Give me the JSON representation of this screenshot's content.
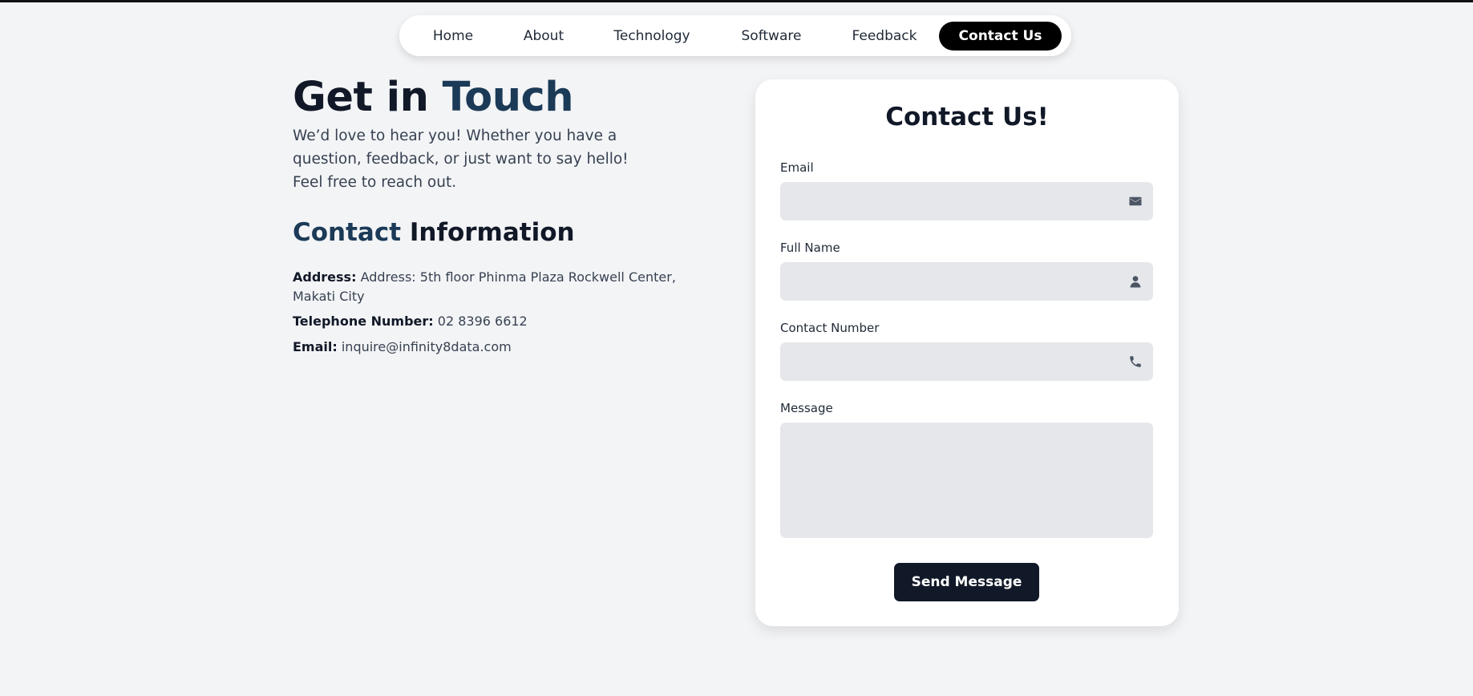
{
  "nav": {
    "items": [
      {
        "label": "Home",
        "active": false
      },
      {
        "label": "About",
        "active": false
      },
      {
        "label": "Technology",
        "active": false
      },
      {
        "label": "Software",
        "active": false
      },
      {
        "label": "Feedback",
        "active": false
      },
      {
        "label": "Contact Us",
        "active": true
      }
    ]
  },
  "hero": {
    "title_part1": "Get in ",
    "title_part2": "Touch",
    "intro": "We’d love to hear you! Whether you have a question, feedback, or just want to say hello! Feel free to reach out."
  },
  "contact_info": {
    "heading_part1": "Contact",
    "heading_part2": " Information",
    "address_label": "Address:",
    "address_value": " Address: 5th floor Phinma Plaza Rockwell Center, Makati City",
    "phone_label": "Telephone Number:",
    "phone_value": " 02 8396 6612",
    "email_label": "Email:",
    "email_value": " inquire@infinity8data.com"
  },
  "form": {
    "title": "Contact Us!",
    "email_label": "Email",
    "email_icon": "envelope-icon",
    "name_label": "Full Name",
    "name_icon": "user-icon",
    "phone_label": "Contact Number",
    "phone_icon": "phone-icon",
    "message_label": "Message",
    "submit_label": "Send Message"
  },
  "colors": {
    "background": "#f3f4f6",
    "accent": "#1b3a57",
    "dark": "#111827",
    "field": "#e5e7eb",
    "nav_active": "#000000"
  }
}
